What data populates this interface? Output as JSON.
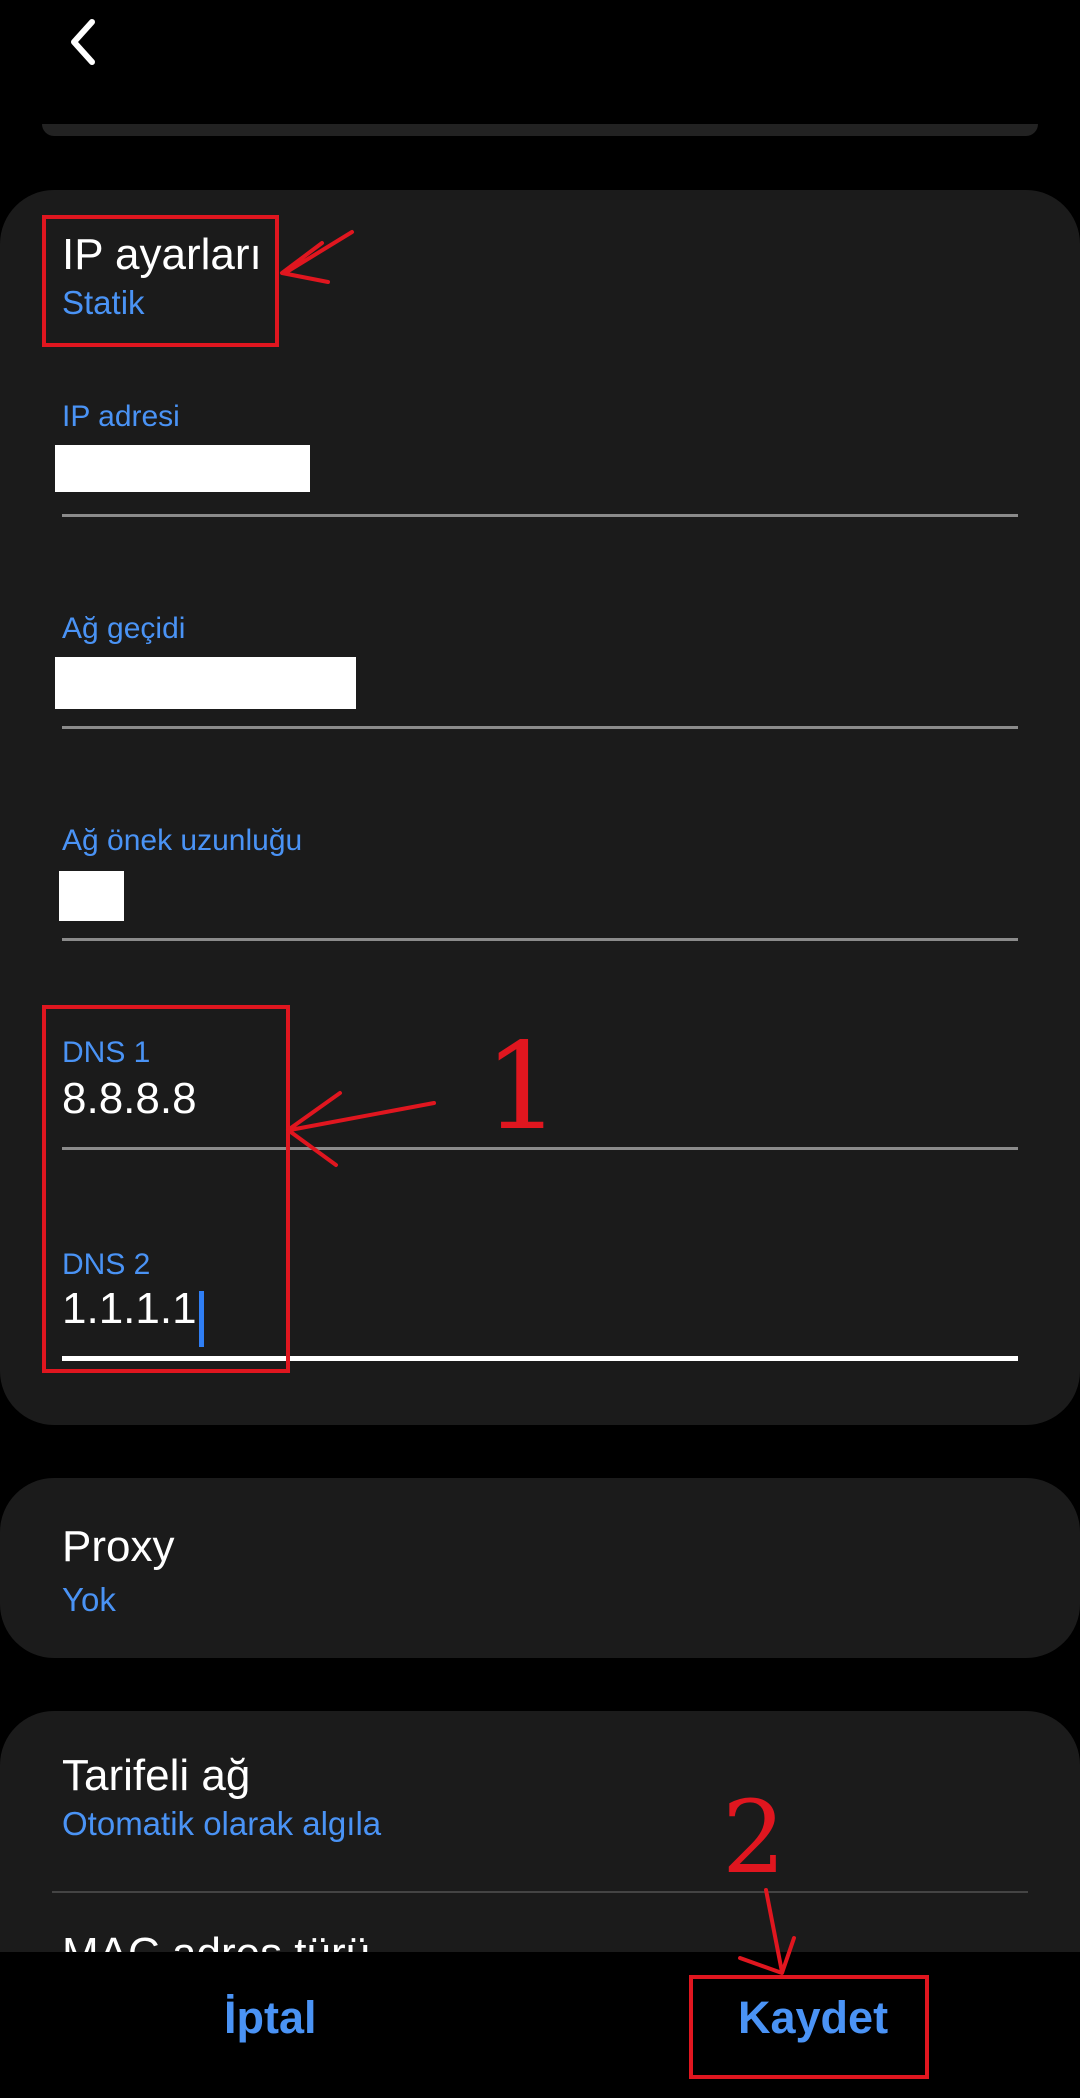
{
  "header": {
    "back_icon": "chevron-left-icon"
  },
  "ip_settings": {
    "title": "IP ayarları",
    "value": "Statik",
    "fields": [
      {
        "label": "IP adresi",
        "value": ""
      },
      {
        "label": "Ağ geçidi",
        "value": ""
      },
      {
        "label": "Ağ önek uzunluğu",
        "value": ""
      },
      {
        "label": "DNS 1",
        "value": "8.8.8.8"
      },
      {
        "label": "DNS 2",
        "value": "1.1.1.1"
      }
    ]
  },
  "proxy": {
    "title": "Proxy",
    "value": "Yok"
  },
  "metered": {
    "title": "Tarifeli ağ",
    "value": "Otomatik olarak algıla"
  },
  "mac": {
    "title": "MAC adres türü"
  },
  "footer": {
    "cancel_label": "İptal",
    "save_label": "Kaydet"
  },
  "annotations": {
    "step1": "1",
    "step2": "2",
    "color": "#e0161f"
  },
  "colors": {
    "accent": "#4a93f5",
    "card": "#1b1b1b",
    "background": "#000000"
  }
}
